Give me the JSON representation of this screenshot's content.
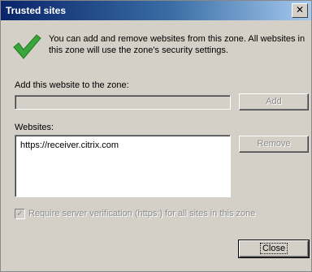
{
  "window": {
    "title": "Trusted sites",
    "close_glyph": "✕"
  },
  "info": {
    "icon": "green-check-icon",
    "text": "You can add and remove websites from this zone. All websites in this zone will use the zone's security settings."
  },
  "add": {
    "label": "Add this website to the zone:",
    "value": "",
    "button": "Add"
  },
  "websites": {
    "label": "Websites:",
    "items": [
      "https://receiver.citrix.com"
    ],
    "remove_button": "Remove"
  },
  "require_https": {
    "label": "Require server verification (https:) for all sites in this zone",
    "checked": true
  },
  "close_button": "Close",
  "colors": {
    "check_green": "#3aa53a",
    "titlebar": "#0a246a",
    "face": "#d4d0c8"
  }
}
